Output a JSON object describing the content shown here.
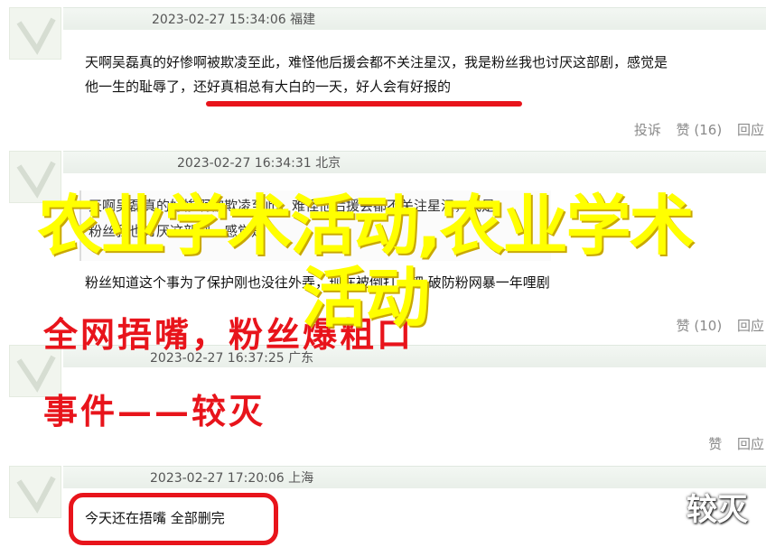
{
  "comments": [
    {
      "meta": "2023-02-27 15:34:06 福建",
      "line1": "天啊吴磊真的好惨啊被欺凌至此，难怪他后援会都不关注星汉，我是粉丝我也讨厌这部剧，感觉是",
      "line2": "他一生的耻辱了，还好真相总有大白的一天，好人会有好报的",
      "actions": {
        "report": "投诉",
        "like": "赞 (16)",
        "reply": "回应"
      }
    },
    {
      "meta": "2023-02-27 16:34:31 北京",
      "quote_line1": "天啊吴磊真的好惨啊被欺凌至此，难怪他后援会都不关注星汉，我是",
      "quote_line2": "粉丝我也讨厌这部剧，感觉是",
      "reply_line": "粉丝知道这个事为了保护刚也没往外弄，现在被倒打一耙 破防粉网暴一年哩剧",
      "actions": {
        "like": "赞 (10)",
        "reply": "回应"
      }
    },
    {
      "meta": "2023-02-27 16:37:25 广东",
      "actions": {
        "like": "赞",
        "reply": "回应"
      }
    },
    {
      "meta": "2023-02-27 17:20:06 上海",
      "text": "今天还在捂嘴 全部删完"
    }
  ],
  "overlay": {
    "title": "农业学术活动,农业学术活动"
  },
  "headline": {
    "line1": "全网捂嘴，粉丝爆粗口",
    "line2": "事件——较灭"
  },
  "watermark": "较灭",
  "colors": {
    "accent_red": "#e8141b",
    "overlay_yellow": "#ffff00"
  }
}
